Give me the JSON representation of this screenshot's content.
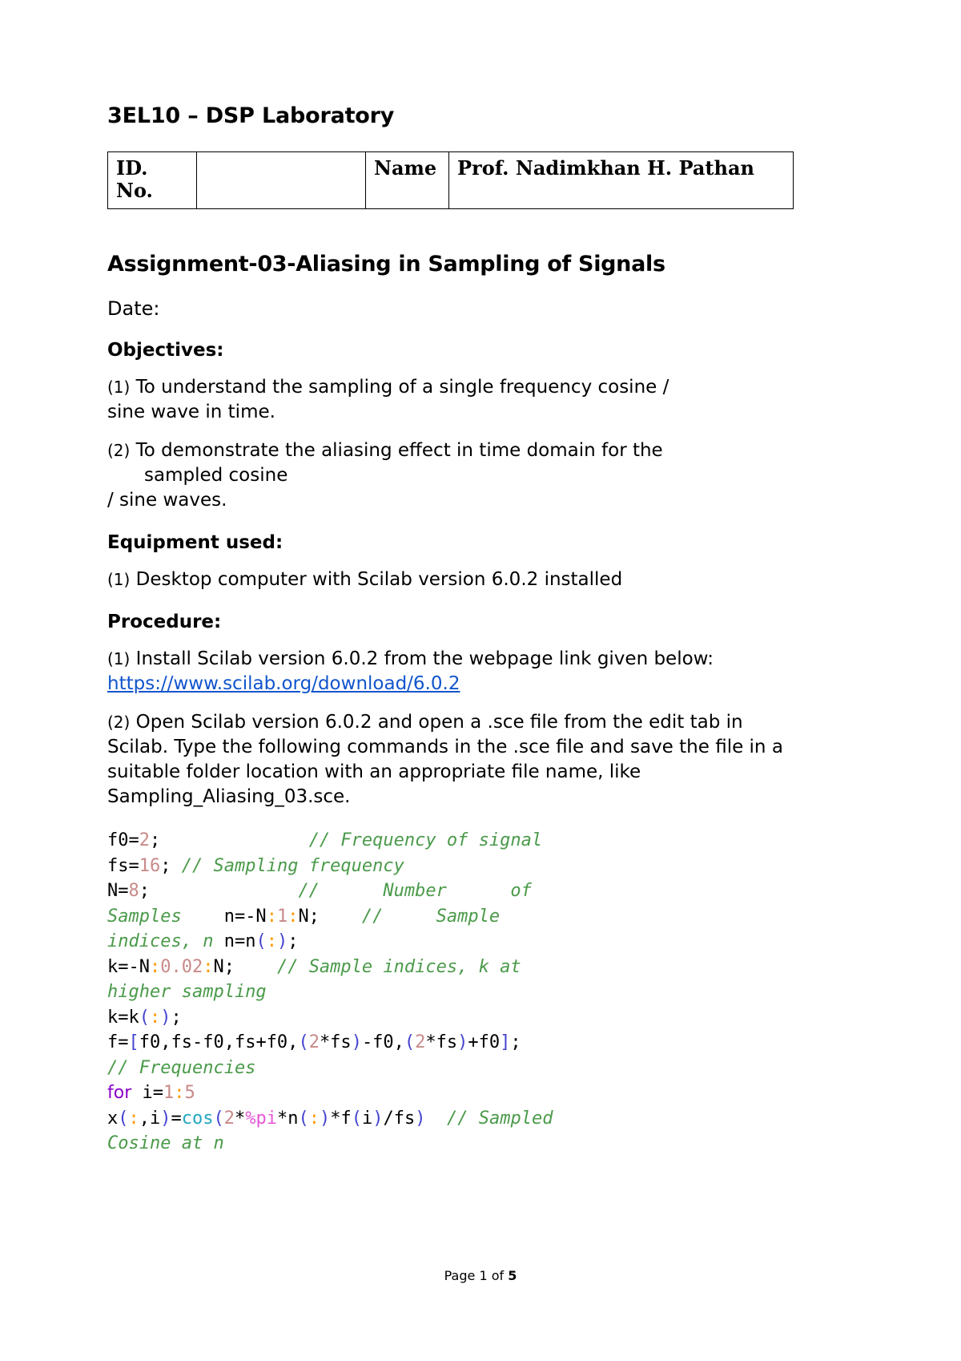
{
  "document": {
    "title": "3EL10 – DSP Laboratory",
    "assignment_heading": "Assignment-03-Aliasing in Sampling of Signals",
    "date_label": "Date:"
  },
  "info_table": {
    "id_label": "ID. No.",
    "id_value": "",
    "name_label": "Name",
    "name_value": "Prof. Nadimkhan H. Pathan"
  },
  "objectives": {
    "heading": "Objectives:",
    "items": [
      {
        "number": "(1)",
        "text_line1": "To understand the sampling of a single frequency cosine /",
        "text_line2": "sine wave in time."
      },
      {
        "number": "(2)",
        "text_line1": "To demonstrate the aliasing effect in time domain for the",
        "text_line2": "sampled cosine",
        "text_line3": "/ sine waves."
      }
    ]
  },
  "equipment": {
    "heading": "Equipment used:",
    "items": [
      {
        "number": "(1)",
        "text": "Desktop computer with Scilab version 6.0.2 installed"
      }
    ]
  },
  "procedure": {
    "heading": "Procedure:",
    "step1": {
      "number": "(1)",
      "text": "Install Scilab version 6.0.2 from the webpage link given below:",
      "link_text": "https://www.scilab.org/download/6.0.2"
    },
    "step2": {
      "number": "(2)",
      "text": "Open Scilab version 6.0.2 and open a .sce file from the edit tab in Scilab. Type the following commands in the .sce file and save the file in a suitable folder location with an appropriate file name, like Sampling_Aliasing_03.sce."
    }
  },
  "code_block": {
    "language": "scilab",
    "lines": [
      "f0=2;              // Frequency of signal",
      "fs=16; // Sampling frequency",
      "N=8;              //     Number     of",
      "Samples    n=-N:1:N;    //     Sample",
      "indices, n n=n(:);",
      "k=-N:0.02:N;    // Sample indices, k at",
      "higher sampling",
      "k=k(:);",
      "f=[f0,fs-f0,fs+f0,(2*fs)-f0,(2*fs)+f0];",
      "// Frequencies",
      "for i=1:5",
      "x(:,i)=cos(2*%pi*n(:)*f(i)/fs)  // Sampled",
      "Cosine at n"
    ],
    "tokens": {
      "comment_color": "#4a9a4a",
      "number_color": "#c98a8a",
      "operator_color": "#ff9900",
      "bracket_color": "#4343d0",
      "keyword_color": "#8b00c8",
      "function_color": "#22a8c0",
      "constant_color": "#e857d8"
    }
  },
  "footer": {
    "prefix": "Page 1 of ",
    "total_pages": "5"
  },
  "colors": {
    "link": "#1155cc",
    "text": "#000000",
    "background": "#ffffff"
  }
}
